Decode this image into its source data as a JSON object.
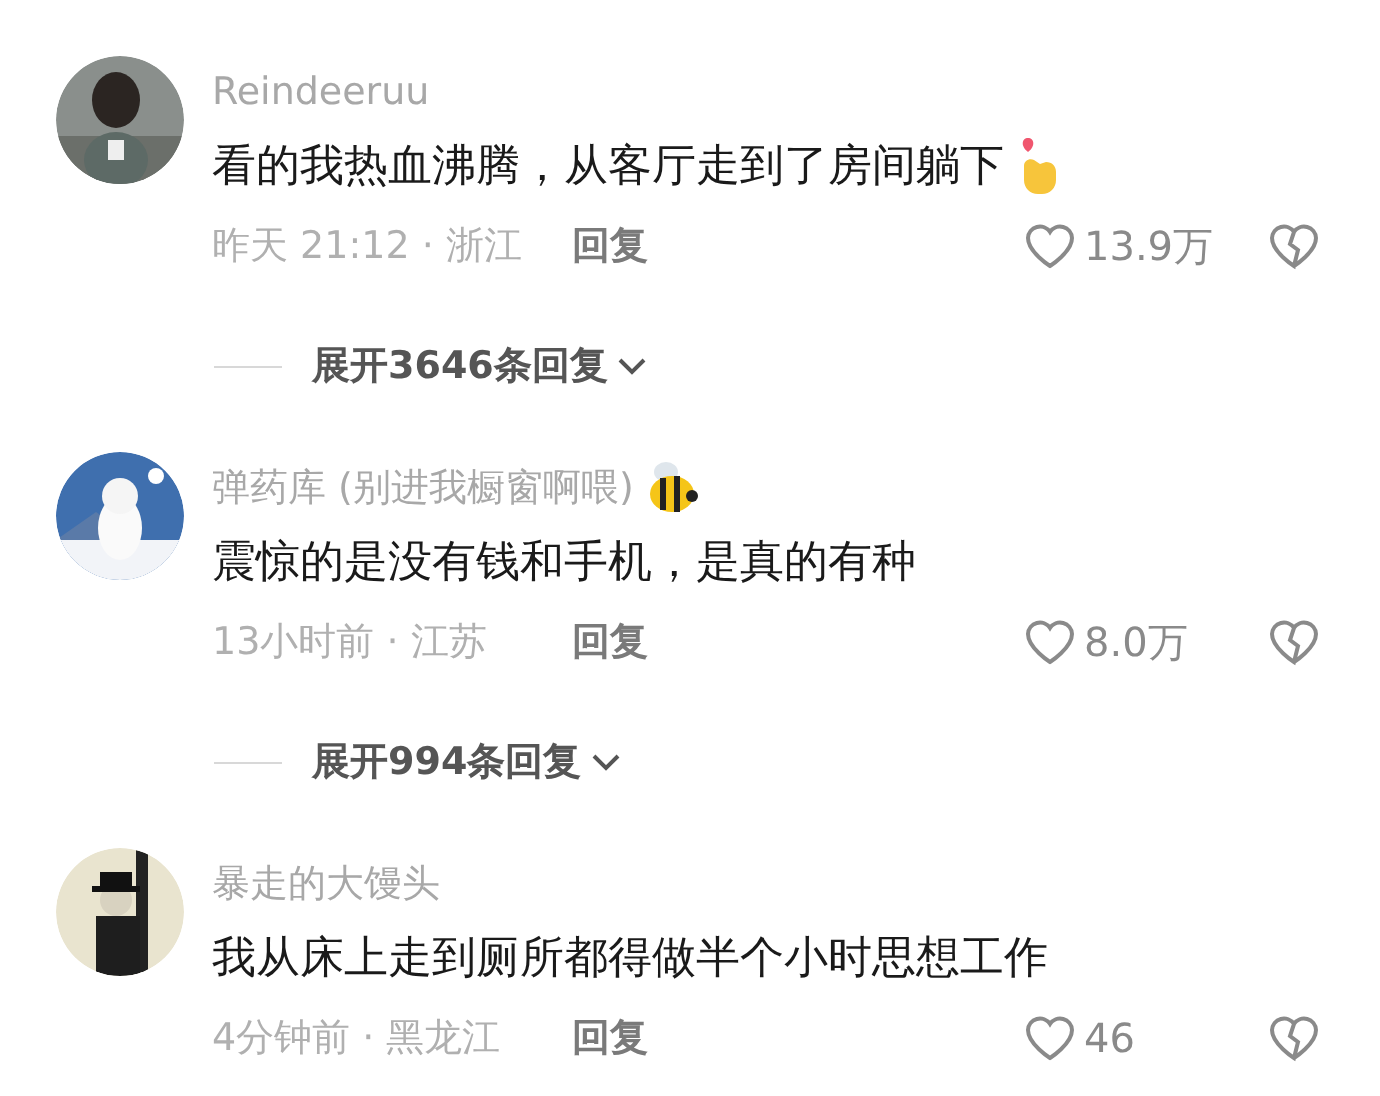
{
  "comments": [
    {
      "author": "Reindeeruu",
      "text": "看的我热血沸腾，从客厅走到了房间躺下",
      "sticker": {
        "kind": "heart"
      },
      "meta": "昨天 21:12 · 浙江",
      "reply": "回复",
      "likes": "13.9万",
      "expand": "展开3646条回复"
    },
    {
      "author": "弹药库 (别进我橱窗啊喂)",
      "text": "震惊的是没有钱和手机，是真的有种",
      "sticker": {
        "kind": "bee"
      },
      "meta": "13小时前 · 江苏",
      "reply": "回复",
      "likes": "8.0万",
      "expand": "展开994条回复"
    },
    {
      "author": "暴走的大馒头",
      "text": "我从床上走到厕所都得做半个小时思想工作",
      "meta": "4分钟前 · 黑龙江",
      "reply": "回复",
      "likes": "46"
    }
  ]
}
